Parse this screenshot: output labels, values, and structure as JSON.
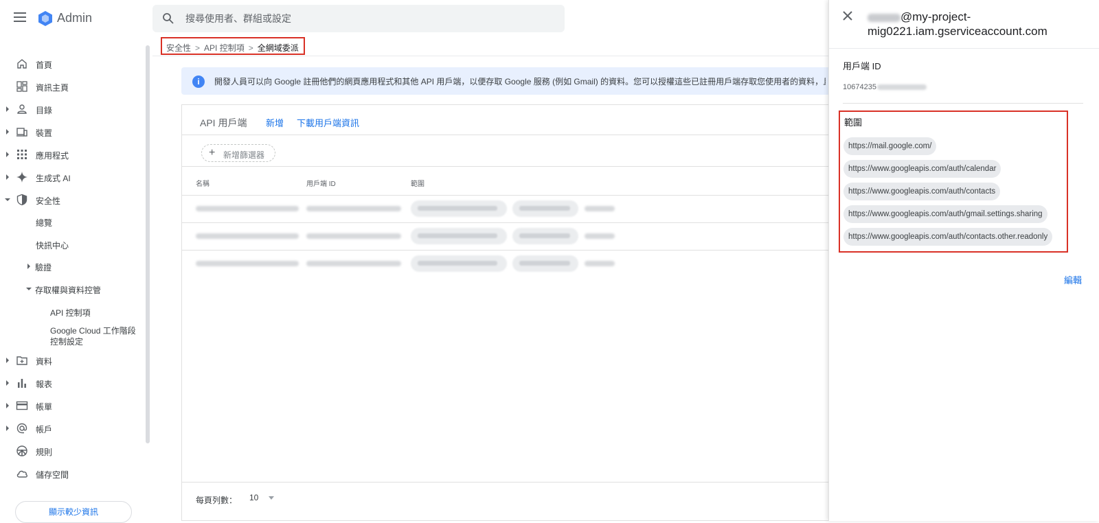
{
  "app": {
    "title": "Admin"
  },
  "search": {
    "placeholder": "搜尋使用者、群組或設定"
  },
  "sidebar": {
    "items": [
      {
        "label": "首頁",
        "icon": "home-icon"
      },
      {
        "label": "資訊主頁",
        "icon": "dashboard-icon"
      },
      {
        "label": "目錄",
        "icon": "person-icon"
      },
      {
        "label": "裝置",
        "icon": "devices-icon"
      },
      {
        "label": "應用程式",
        "icon": "apps-grid-icon"
      },
      {
        "label": "生成式 AI",
        "icon": "sparkle-icon"
      },
      {
        "label": "安全性",
        "icon": "shield-icon"
      }
    ],
    "security_children": {
      "overview": "總覽",
      "alert_center": "快訊中心",
      "authentication": "驗證",
      "access_data_control": "存取權與資料控管",
      "api_controls": "API 控制項",
      "gcloud_session": "Google Cloud 工作階段控制設定"
    },
    "items_after": [
      {
        "label": "資料",
        "icon": "folder-icon"
      },
      {
        "label": "報表",
        "icon": "bar-chart-icon"
      },
      {
        "label": "帳單",
        "icon": "credit-card-icon"
      },
      {
        "label": "帳戶",
        "icon": "at-sign-icon"
      },
      {
        "label": "規則",
        "icon": "steering-icon"
      },
      {
        "label": "儲存空間",
        "icon": "cloud-icon"
      }
    ],
    "show_less": "顯示較少資訊"
  },
  "breadcrumb": {
    "level1": "安全性",
    "level2": "API 控制項",
    "current": "全網域委派"
  },
  "banner": {
    "text": "開發人員可以向 Google 註冊他們的網頁應用程式和其他 API 用戶端，以便存取 Google 服務 (例如 Gmail) 的資料。您可以授權這些已註冊用戶端存取您使用者的資料，且不必一"
  },
  "table": {
    "title": "API 用戶端",
    "add": "新增",
    "download": "下載用戶端資訊",
    "filter": "新增篩選器",
    "columns": {
      "name": "名稱",
      "client_id": "用戶端 ID",
      "scopes": "範圍"
    },
    "rows_per_page_label": "每頁列數：",
    "rows_per_page": "10"
  },
  "panel": {
    "title_suffix": "@my-project-mig0221.iam.gserviceaccount.com",
    "client_id_label": "用戶端 ID",
    "client_id_prefix": "10674235",
    "scopes_label": "範圍",
    "scopes": [
      "https://mail.google.com/",
      "https://www.googleapis.com/auth/calendar",
      "https://www.googleapis.com/auth/contacts",
      "https://www.googleapis.com/auth/gmail.settings.sharing",
      "https://www.googleapis.com/auth/contacts.other.readonly"
    ],
    "edit": "編輯"
  },
  "colors": {
    "accent": "#1a73e8",
    "highlight": "#d93025",
    "banner_bg": "#e8f0fe"
  }
}
